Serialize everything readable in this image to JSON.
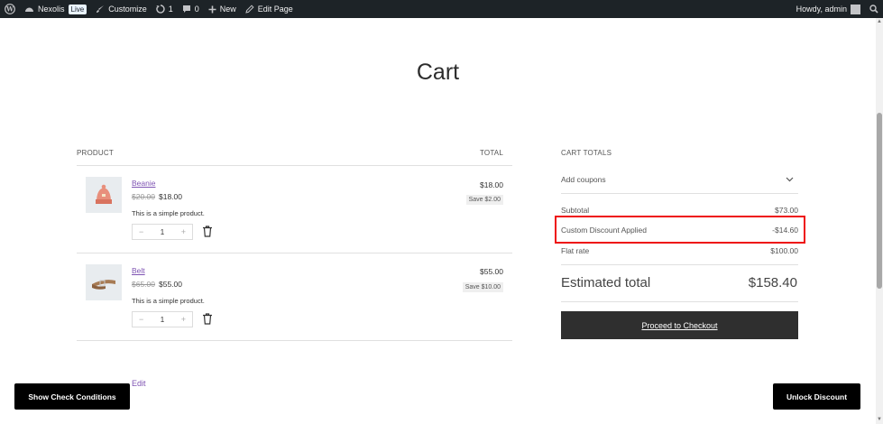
{
  "adminbar": {
    "site_name": "Nexolis",
    "live_badge": "Live",
    "customize": "Customize",
    "updates_count": "1",
    "comments_count": "0",
    "new": "New",
    "edit_page": "Edit Page",
    "howdy": "Howdy, admin"
  },
  "page": {
    "title": "Cart"
  },
  "cart": {
    "product_header": "PRODUCT",
    "total_header": "TOTAL",
    "items": [
      {
        "name": "Beanie",
        "old_price": "$20.00",
        "price": "$18.00",
        "description": "This is a simple product.",
        "quantity": "1",
        "line_total": "$18.00",
        "save": "Save $2.00"
      },
      {
        "name": "Belt",
        "old_price": "$65.00",
        "price": "$55.00",
        "description": "This is a simple product.",
        "quantity": "1",
        "line_total": "$55.00",
        "save": "Save $10.00"
      }
    ],
    "qty_minus": "−",
    "qty_plus": "+"
  },
  "totals": {
    "header": "CART TOTALS",
    "coupons": "Add coupons",
    "subtotal_label": "Subtotal",
    "subtotal_value": "$73.00",
    "discount_label": "Custom Discount Applied",
    "discount_value": "-$14.60",
    "flat_rate_label": "Flat rate",
    "flat_rate_value": "$100.00",
    "estimated_label": "Estimated total",
    "estimated_value": "$158.40",
    "checkout_button": "Proceed to Checkout"
  },
  "edit_link": "Edit",
  "buttons": {
    "show_conditions": "Show Check Conditions",
    "unlock_discount": "Unlock Discount"
  },
  "colors": {
    "adminbar_bg": "#1d2327",
    "link_purple": "#7f54b3",
    "highlight_red": "#e11111",
    "checkout_bg": "#2f2f2f"
  }
}
